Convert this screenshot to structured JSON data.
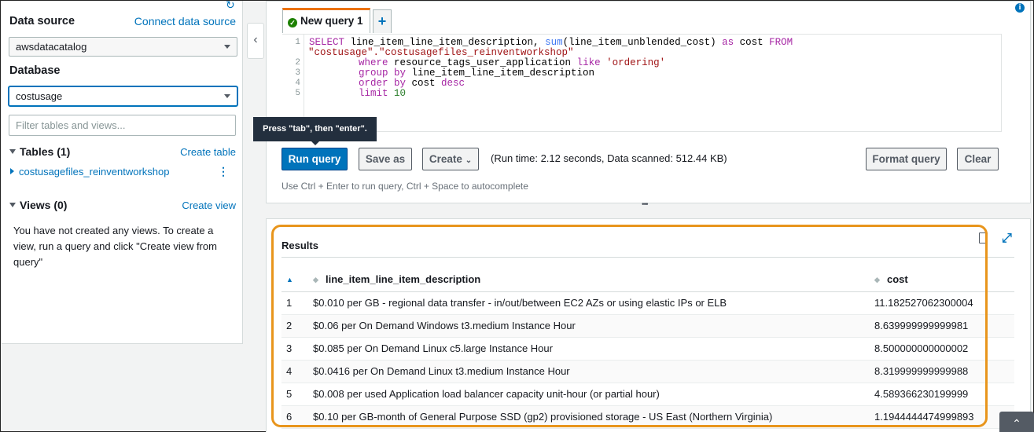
{
  "sidebar": {
    "data_source_label": "Data source",
    "connect_link": "Connect data source",
    "data_source_value": "awsdatacatalog",
    "database_label": "Database",
    "database_value": "costusage",
    "filter_placeholder": "Filter tables and views...",
    "tables_title": "Tables (1)",
    "create_table": "Create table",
    "table_item": "costusagefiles_reinventworkshop",
    "views_title": "Views (0)",
    "create_view": "Create view",
    "views_empty": "You have not created any views. To create a view, run a query and click \"Create view from query\""
  },
  "editor": {
    "tab_label": "New query 1",
    "tab_add": "+",
    "line_numbers": [
      "1",
      "2",
      "3",
      "4",
      "5"
    ],
    "code": {
      "l1_kw1": "SELECT",
      "l1_txt1": " line_item_line_item_description, ",
      "l1_fn": "sum",
      "l1_txt2": "(line_item_unblended_cost) ",
      "l1_kw2": "as",
      "l1_txt3": " cost ",
      "l1_kw3": "FROM",
      "l1b_str": "\"costusage\".\"costusagefiles_reinventworkshop\"",
      "l2_kw": "where",
      "l2_txt": " resource_tags_user_application ",
      "l2_kw2": "like",
      "l2_str": "'ordering'",
      "l3_kw": "group by",
      "l3_txt": " line_item_line_item_description",
      "l4_kw": "order by",
      "l4_txt": " cost ",
      "l4_kw2": "desc",
      "l5_kw": "limit",
      "l5_num": "10"
    },
    "tooltip": "Press \"tab\", then \"enter\".",
    "run_button": "Run query",
    "save_button": "Save as",
    "create_button": "Create",
    "run_info": "(Run time: 2.12 seconds, Data scanned: 512.44 KB)",
    "format_button": "Format query",
    "clear_button": "Clear",
    "hint": "Use Ctrl + Enter to run query, Ctrl + Space to autocomplete"
  },
  "results": {
    "title": "Results",
    "columns": [
      "line_item_line_item_description",
      "cost"
    ],
    "rows": [
      {
        "n": "1",
        "desc": "$0.010 per GB - regional data transfer - in/out/between EC2 AZs or using elastic IPs or ELB",
        "cost": "11.182527062300004"
      },
      {
        "n": "2",
        "desc": "$0.06 per On Demand Windows t3.medium Instance Hour",
        "cost": "8.639999999999981"
      },
      {
        "n": "3",
        "desc": "$0.085 per On Demand Linux c5.large Instance Hour",
        "cost": "8.500000000000002"
      },
      {
        "n": "4",
        "desc": "$0.0416 per On Demand Linux t3.medium Instance Hour",
        "cost": "8.319999999999988"
      },
      {
        "n": "5",
        "desc": "$0.008 per used Application load balancer capacity unit-hour (or partial hour)",
        "cost": "4.589366230199999"
      },
      {
        "n": "6",
        "desc": "$0.10 per GB-month of General Purpose SSD (gp2) provisioned storage - US East (Northern Virginia)",
        "cost": "1.1944444474999893"
      }
    ]
  },
  "colors": {
    "primary": "#0073bb",
    "highlight": "#e8951c",
    "tab_accent": "#ec7211"
  },
  "icons": [
    "refresh-icon",
    "collapse-chevron-icon",
    "info-icon",
    "download-icon",
    "expand-icon",
    "scroll-top-icon",
    "sort-icon",
    "check-icon"
  ]
}
